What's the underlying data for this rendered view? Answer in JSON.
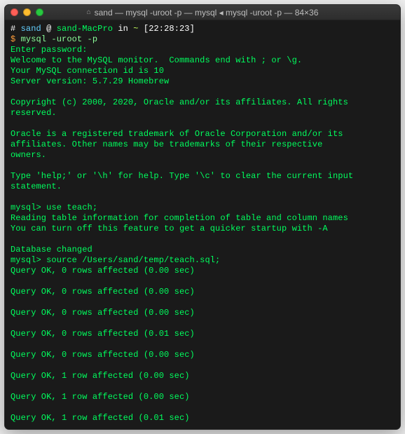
{
  "window": {
    "title": "sand — mysql -uroot -p — mysql ◂ mysql -uroot -p — 84×36"
  },
  "prompt": {
    "hash": "# ",
    "user": "sand",
    "at": " @ ",
    "host": "sand-MacPro",
    "in": " in ",
    "path": "~",
    "time": " [22:28:23]",
    "dollar": "$ ",
    "command": "mysql -uroot -p"
  },
  "output": {
    "enterpw": "Enter password:",
    "welcome": "Welcome to the MySQL monitor.  Commands end with ; or \\g.",
    "connid": "Your MySQL connection id is 10",
    "server": "Server version: 5.7.29 Homebrew",
    "copyright": "Copyright (c) 2000, 2020, Oracle and/or its affiliates. All rights reserved.",
    "trade1": "Oracle is a registered trademark of Oracle Corporation and/or its",
    "trade2": "affiliates. Other names may be trademarks of their respective",
    "trade3": "owners.",
    "help": "Type 'help;' or '\\h' for help. Type '\\c' to clear the current input statement.",
    "m1": "mysql> use teach;",
    "read1": "Reading table information for completion of table and column names",
    "read2": "You can turn off this feature to get a quicker startup with -A",
    "dbchanged": "Database changed",
    "m2": "mysql> source /Users/sand/temp/teach.sql;",
    "q1": "Query OK, 0 rows affected (0.00 sec)",
    "q2": "Query OK, 0 rows affected (0.00 sec)",
    "q3": "Query OK, 0 rows affected (0.00 sec)",
    "q4": "Query OK, 0 rows affected (0.01 sec)",
    "q5": "Query OK, 0 rows affected (0.00 sec)",
    "q6": "Query OK, 1 row affected (0.00 sec)",
    "q7": "Query OK, 1 row affected (0.00 sec)",
    "q8": "Query OK, 1 row affected (0.01 sec)"
  }
}
